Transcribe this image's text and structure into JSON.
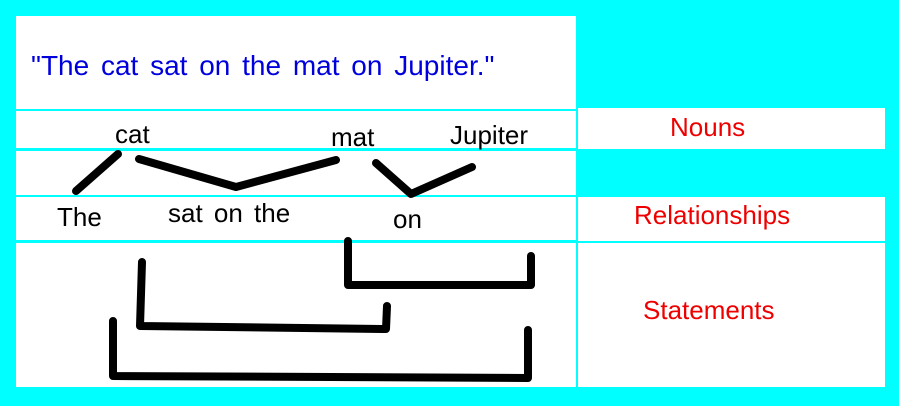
{
  "sentence": "\"The cat sat on the mat on Jupiter.\"",
  "nouns": [
    "cat",
    "mat",
    "Jupiter"
  ],
  "relationship_words": [
    "The",
    "sat on the",
    "on"
  ],
  "labels": {
    "nouns": "Nouns",
    "relationships": "Relationships",
    "statements": "Statements"
  },
  "colors": {
    "background": "#00ffff",
    "panel": "#ffffff",
    "sentence": "#0000dd",
    "label": "#ee0000",
    "ink": "#000000"
  }
}
